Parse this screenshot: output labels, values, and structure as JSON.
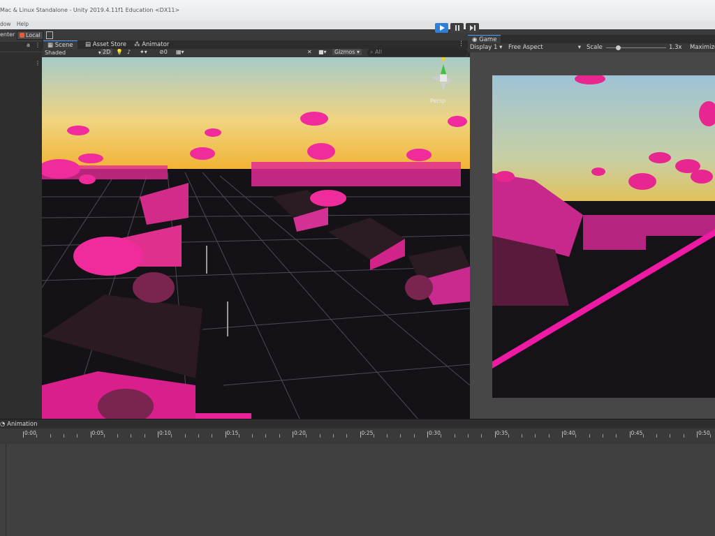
{
  "window": {
    "title": "Mac & Linux Standalone - Unity 2019.4.11f1 Education <DX11>"
  },
  "menu": [
    "dow",
    "Help"
  ],
  "toolbar": {
    "pivot_center_label": "enter",
    "local_label": "Local",
    "play_icon": "play-icon",
    "pause_icon": "pause-icon",
    "step_icon": "step-icon"
  },
  "scene_panel": {
    "tabs": [
      {
        "label": "Scene",
        "icon": "grid-icon"
      },
      {
        "label": "Asset Store",
        "icon": "store-icon"
      },
      {
        "label": "Animator",
        "icon": "animator-icon"
      }
    ],
    "shading_mode": "Shaded",
    "render_toggle": "2D",
    "gizmos_label": "Gizmos",
    "search_placeholder": "All",
    "projection_label": "Persp"
  },
  "game_panel": {
    "tab_label": "Game",
    "display": "Display 1",
    "aspect": "Free Aspect",
    "scale_label": "Scale",
    "scale_value": 0.2,
    "scale_text": "1.3x",
    "maximize_label": "Maximize"
  },
  "animation_panel": {
    "tab_label": "Animation",
    "time_labels": [
      "0:00",
      "0:05",
      "0:10",
      "0:15",
      "0:20",
      "0:25",
      "0:30",
      "0:35",
      "0:40",
      "0:45",
      "0:50"
    ]
  },
  "colors": {
    "accent": "#4aa0ff",
    "magenta": "#e0208f",
    "sky_top": "#a9c8c8",
    "sky_horizon": "#f2c23a"
  }
}
